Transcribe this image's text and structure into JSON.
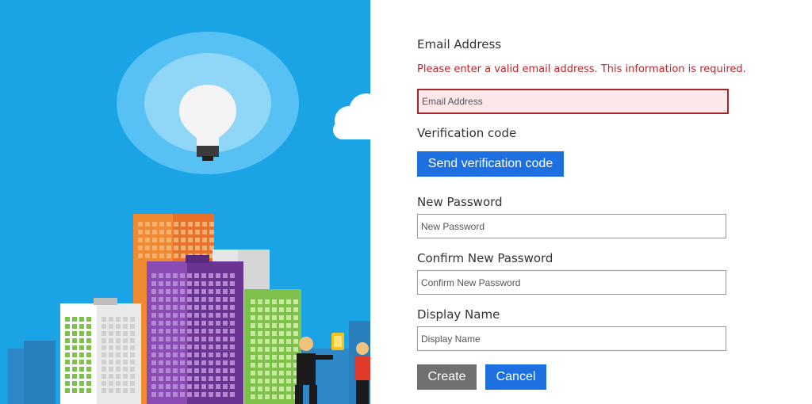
{
  "form": {
    "email_label": "Email Address",
    "email_error": "Please enter a valid email address. This information is required.",
    "email_placeholder": "Email Address",
    "verification_label": "Verification code",
    "send_code_label": "Send verification code",
    "new_password_label": "New Password",
    "new_password_placeholder": "New Password",
    "confirm_password_label": "Confirm New Password",
    "confirm_password_placeholder": "Confirm New Password",
    "display_name_label": "Display Name",
    "display_name_placeholder": "Display Name",
    "create_label": "Create",
    "cancel_label": "Cancel"
  },
  "colors": {
    "hero_background": "#1aa4e6",
    "primary_button": "#1e6fe0",
    "secondary_button": "#707070",
    "error_text": "#c0262d",
    "error_field_border": "#a4262c",
    "error_field_background": "#fde7e9"
  }
}
